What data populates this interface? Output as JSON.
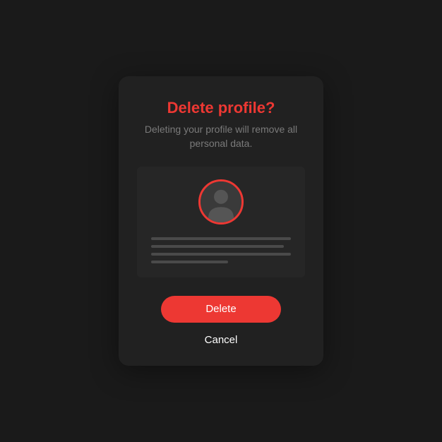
{
  "modal": {
    "title": "Delete profile?",
    "subtitle": "Deleting your profile will remove all personal data.",
    "buttons": {
      "primary": "Delete",
      "secondary": "Cancel"
    }
  },
  "colors": {
    "accent": "#ed3833",
    "background": "#1a1a1a",
    "modalBackground": "#212121",
    "cardBackground": "#262626",
    "mutedText": "#7a7a7a"
  }
}
